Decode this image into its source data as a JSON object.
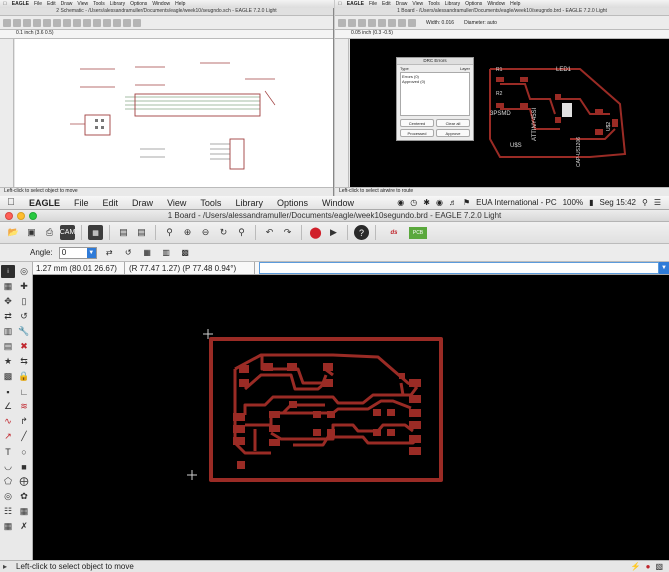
{
  "menubar": {
    "app_name": "EAGLE",
    "items": [
      "File",
      "Edit",
      "Draw",
      "View",
      "Tools",
      "Library",
      "Options",
      "Window"
    ],
    "input_source": "EUA International - PC",
    "battery": "100%",
    "clock": "Seg 15:42"
  },
  "mini_left": {
    "app_name": "EAGLE",
    "items": [
      "File",
      "Edit",
      "Draw",
      "View",
      "Tools",
      "Library",
      "Options",
      "Window",
      "Help"
    ],
    "window_title": "2 Schematic - /Users/alessandramuller/Documents/eagle/week10/seugndo.sch - EAGLE 7.2.0 Light",
    "coord": "0.1 inch (3.6 0.5)",
    "status": "Left-click to select object to move"
  },
  "mini_right": {
    "app_name": "EAGLE",
    "items": [
      "File",
      "Edit",
      "Draw",
      "View",
      "Tools",
      "Library",
      "Options",
      "Window",
      "Help"
    ],
    "window_title": "1 Board - /Users/alessandramuller/Documents/eagle/week10/seugndo.brd - EAGLE 7.2.0 Light",
    "coord": "0.05 inch (0.3 -0.5)",
    "width_label": "Width: 0.016",
    "diameter_label": "Diameter: auto",
    "status": "Left-click to select airwire to route",
    "drc": {
      "title": "DRC Errors",
      "col_type": "Type",
      "col_layer": "Layer",
      "errors": "Errors (0)",
      "approved": "Approved (0)",
      "btn_centered": "Centered",
      "btn_clear_all": "Clear all",
      "btn_processed": "Processed",
      "btn_approve": "Approve"
    },
    "labels": [
      "LED1",
      "R1",
      "R2",
      "3PSMD",
      "ATTINY45SI",
      "U$S",
      "CAP-US1206",
      "U$2"
    ]
  },
  "window": {
    "title": "1 Board - /Users/alessandramuller/Documents/eagle/week10segundo.brd - EAGLE 7.2.0 Light",
    "angle_label": "Angle:",
    "angle_value": "0",
    "grid_readout": "1.27 mm (80.01 26.67)",
    "pos_readout": "(R 77.47 1.27) (P 77.48 0.94°)",
    "command_value": "",
    "status_text": "Left-click to select object to move"
  },
  "colors": {
    "trace": "#9a2b25",
    "board_bg": "#000000",
    "select_blue": "#2f7bd8"
  }
}
